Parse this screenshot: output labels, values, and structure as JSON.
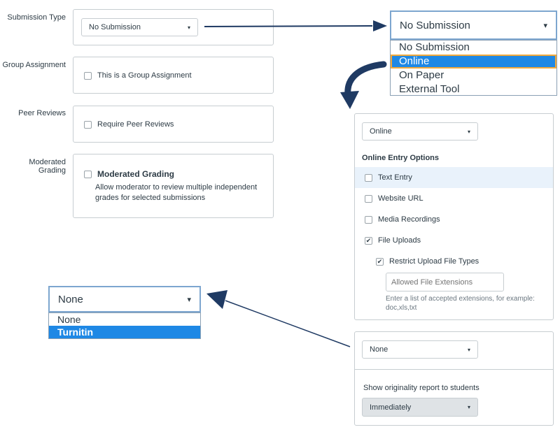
{
  "settings": {
    "submission_type": {
      "label": "Submission Type",
      "value": "No Submission"
    },
    "group_assignment": {
      "label": "Group Assignment",
      "checkbox": "This is a Group Assignment"
    },
    "peer_reviews": {
      "label": "Peer Reviews",
      "checkbox": "Require Peer Reviews"
    },
    "moderated_grading": {
      "label": "Moderated Grading",
      "checkbox_title": "Moderated Grading",
      "description_1": "Allow moderator to review multiple independent",
      "description_2": "grades for selected submissions"
    }
  },
  "submission_dropdown": {
    "selected": "No Submission",
    "options": [
      "No Submission",
      "Online",
      "On Paper",
      "External Tool"
    ],
    "highlighted": "Online"
  },
  "online_panel": {
    "select_value": "Online",
    "heading": "Online Entry Options",
    "options": [
      {
        "label": "Text Entry",
        "checked": false
      },
      {
        "label": "Website URL",
        "checked": false
      },
      {
        "label": "Media Recordings",
        "checked": false
      },
      {
        "label": "File Uploads",
        "checked": true
      }
    ],
    "restrict": {
      "label": "Restrict Upload File Types",
      "checked": true
    },
    "extensions_placeholder": "Allowed File Extensions",
    "hint_1": "Enter a list of accepted extensions, for example:",
    "hint_2": "doc,xls,txt"
  },
  "plagiarism_panel": {
    "select_value": "None",
    "report_label": "Show originality report to students",
    "report_value": "Immediately"
  },
  "plagiarism_dropdown": {
    "selected": "None",
    "options": [
      "None",
      "Turnitin"
    ],
    "highlighted": "Turnitin"
  },
  "icons": {
    "caret": "▾",
    "check": "✔"
  },
  "colors": {
    "highlight": "#1e88e5",
    "arrow": "#1f3a63",
    "focus_outline": "#f2a93b"
  }
}
